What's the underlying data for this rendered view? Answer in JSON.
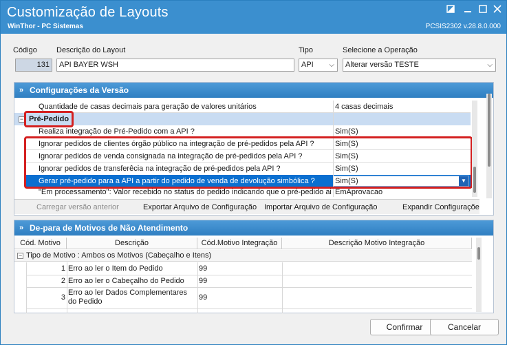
{
  "window": {
    "title": "Customização de Layouts",
    "subtitle": "WinThor - PC Sistemas",
    "version": "PCSIS2302  v.28.8.0.000",
    "restore_icon": "restore-icon",
    "minimize_icon": "minimize-icon",
    "maximize_icon": "maximize-icon",
    "close_icon": "close-icon"
  },
  "form": {
    "codigo_label": "Código",
    "codigo_value": "131",
    "descricao_label": "Descrição do Layout",
    "descricao_value": "API BAYER WSH",
    "tipo_label": "Tipo",
    "tipo_value": "API",
    "operacao_label": "Selecione a Operação",
    "operacao_value": "Alterar versão TESTE"
  },
  "config_panel": {
    "title": "Configurações da Versão",
    "rows": [
      {
        "label": "Quantidade de casas decimais para geração de valores unitários",
        "value": "4 casas decimais"
      },
      {
        "label": "Realiza integração de Pré-Pedido com a API ?",
        "value": "Sim(S)"
      },
      {
        "label": "Ignorar pedidos de clientes órgão público na integração de pré-pedidos pela API ?",
        "value": "Sim(S)"
      },
      {
        "label": "Ignorar pedidos de venda consignada na integração de pré-pedidos pela API ?",
        "value": "Sim(S)"
      },
      {
        "label": "Ignorar pedidos de transferêcia na integração de pré-pedidos pela API ?",
        "value": "Sim(S)"
      },
      {
        "label": "Gerar pré-pedido para a API a partir do pedido de venda de devolução simbólica ?",
        "value": "Sim(S)"
      },
      {
        "label": "\"Em processamento\": Valor recebido no status do pedido indicando que o pré-pedido ainc",
        "value": "EmAprovacao"
      }
    ],
    "group_label": "Pré-Pedido",
    "actions": {
      "carregar": "Carregar versão anterior",
      "exportar": "Exportar Arquivo de Configuração",
      "importar": "Importar Arquivo de Configuração",
      "expandir": "Expandir Configurações"
    }
  },
  "depara_panel": {
    "title": "De-para de Motivos de Não Atendimento",
    "columns": [
      "Cód. Motivo",
      "Descrição",
      "Cód.Motivo Integração",
      "Descrição Motivo Integração"
    ],
    "group_label": "Tipo de Motivo : Ambos os Motivos (Cabeçalho e Itens)",
    "rows": [
      {
        "cod": "1",
        "descricao": "Erro ao ler o Item do Pedido",
        "integracao": "99"
      },
      {
        "cod": "2",
        "descricao": "Erro ao ler o Cabeçalho do Pedido",
        "integracao": "99"
      },
      {
        "cod": "3",
        "descricao": "Erro ao ler Dados Complementares do Pedido",
        "integracao": "99"
      }
    ]
  },
  "footer": {
    "confirmar": "Confirmar",
    "cancelar": "Cancelar"
  },
  "colors": {
    "titlebar": "#3b8fcf",
    "panel_header": "#2f7fc2",
    "selection": "#0a6fd0",
    "highlight_border": "#d42020"
  }
}
